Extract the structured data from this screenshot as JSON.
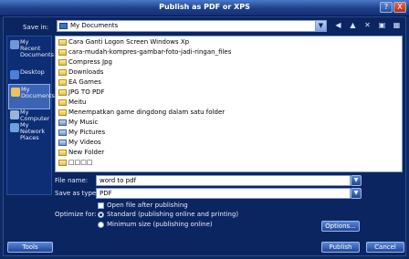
{
  "window": {
    "title": "Publish as PDF or XPS",
    "help": "?",
    "close": "X"
  },
  "save_in": {
    "label": "Save in:",
    "value": "My Documents"
  },
  "places": [
    {
      "label": "My Recent Documents",
      "icon": "recent-documents-icon",
      "color": "#6f96d9"
    },
    {
      "label": "Desktop",
      "icon": "desktop-icon",
      "color": "#4d7fd6"
    },
    {
      "label": "My Documents",
      "icon": "my-documents-icon",
      "color": "#e9c45a"
    },
    {
      "label": "My Computer",
      "icon": "my-computer-icon",
      "color": "#9bb3d9"
    },
    {
      "label": "My Network Places",
      "icon": "network-places-icon",
      "color": "#6fa0e0"
    }
  ],
  "files": [
    {
      "name": "Cara Ganti Logon Screen Windows Xp",
      "type": "folder"
    },
    {
      "name": "cara-mudah-kompres-gambar-foto-jadi-ringan_files",
      "type": "folder"
    },
    {
      "name": "Compress Jpg",
      "type": "folder"
    },
    {
      "name": "Downloads",
      "type": "folder"
    },
    {
      "name": "EA Games",
      "type": "folder"
    },
    {
      "name": "JPG TO PDF",
      "type": "folder"
    },
    {
      "name": "Meitu",
      "type": "folder"
    },
    {
      "name": "Menempatkan game dingdong dalam satu folder",
      "type": "folder"
    },
    {
      "name": "My Music",
      "type": "special"
    },
    {
      "name": "My Pictures",
      "type": "special"
    },
    {
      "name": "My Videos",
      "type": "special"
    },
    {
      "name": "New Folder",
      "type": "folder"
    },
    {
      "name": "□□□□",
      "type": "folder"
    }
  ],
  "file_name": {
    "label": "File name:",
    "value": "word to pdf"
  },
  "save_as_type": {
    "label": "Save as type:",
    "value": "PDF"
  },
  "open_after": {
    "label": "Open file after publishing",
    "checked": false
  },
  "optimize": {
    "label": "Optimize for:",
    "options": [
      {
        "label": "Standard (publishing online and printing)",
        "selected": true
      },
      {
        "label": "Minimum size (publishing online)",
        "selected": false
      }
    ]
  },
  "buttons": {
    "options": "Options...",
    "tools": "Tools",
    "publish": "Publish",
    "cancel": "Cancel"
  }
}
